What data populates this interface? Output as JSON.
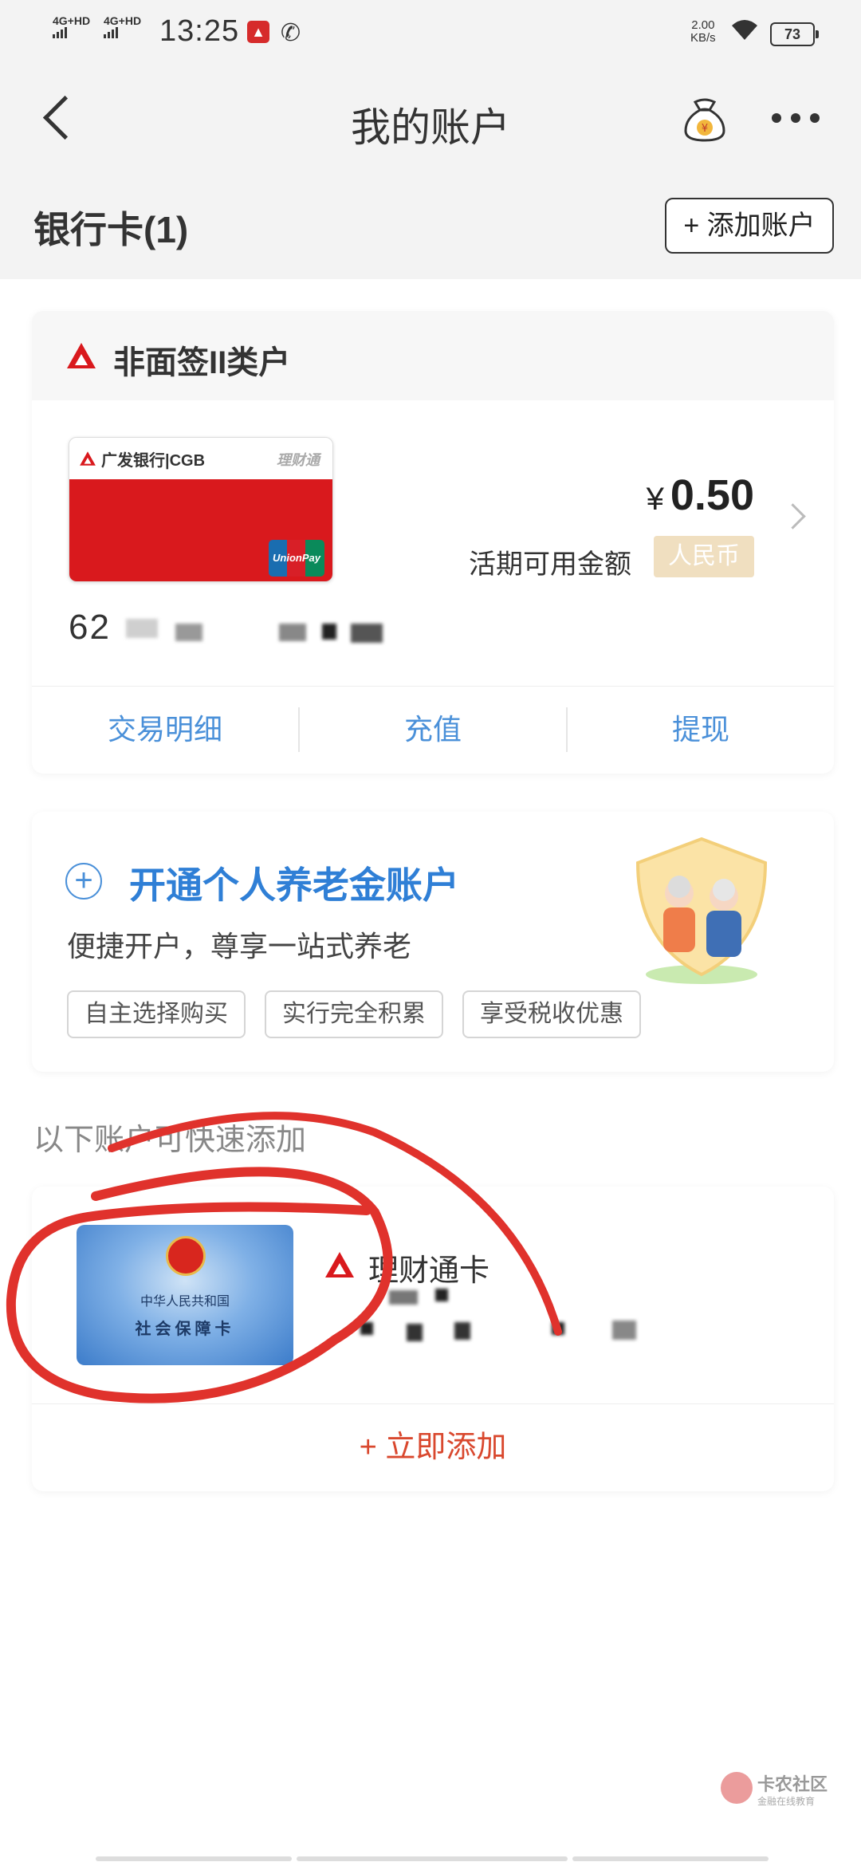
{
  "status_bar": {
    "signal_1": "4G+HD",
    "signal_2": "4G+HD",
    "time": "13:25",
    "speed_value": "2.00",
    "speed_unit": "KB/s",
    "battery": "73"
  },
  "nav": {
    "title": "我的账户"
  },
  "bank_section": {
    "title": "银行卡(1)",
    "add_button": "+ 添加账户"
  },
  "account_card": {
    "type_title": "非面签II类户",
    "card_bank_name": "广发银行|CGB",
    "card_product": "理财通",
    "card_union_label": "UnionPay 银联",
    "card_number_visible": "62",
    "currency_symbol": "¥",
    "amount": "0.50",
    "amount_label": "活期可用金额",
    "currency_badge": "人民币",
    "actions": [
      "交易明细",
      "充值",
      "提现"
    ]
  },
  "pension": {
    "title": "开通个人养老金账户",
    "subtitle": "便捷开户，尊享一站式养老",
    "tags": [
      "自主选择购买",
      "实行完全积累",
      "享受税收优惠"
    ]
  },
  "quick_add": {
    "label": "以下账户可快速添加",
    "card_line1": "中华人民共和国",
    "card_line2": "社会保障卡",
    "account_title": "理财通卡",
    "add_now": "+ 立即添加"
  },
  "watermark": {
    "brand": "卡农社区",
    "slogan": "金融在线教育"
  },
  "colors": {
    "accent_blue": "#4a90d9",
    "brand_red": "#d9191d",
    "annotation_red": "#e0322c"
  }
}
